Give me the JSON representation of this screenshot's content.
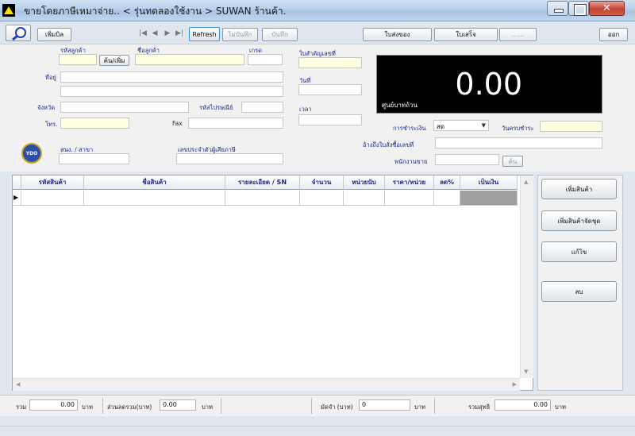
{
  "window": {
    "title": "ขายโดยภาษีเหมาจ่าย.. < รุ่นทดลองใช้งาน > SUWAN ร้านค้า.",
    "minimize_glyph": "—",
    "maximize_glyph": "☐",
    "close_glyph": "✕"
  },
  "toolbar": {
    "new_bill_label": "เพิ่มบิล",
    "nav_first": "|◀",
    "nav_prev": "◀",
    "nav_next": "▶",
    "nav_last": "▶|",
    "refresh_label": "Refresh",
    "cancel_save_label": "ไม่บันทึก",
    "save_label": "บันทึก",
    "delivery_note_label": "ใบส่งของ",
    "receipt_label": "ใบเสร็จ",
    "more_label": "......",
    "exit_label": "ออก"
  },
  "form": {
    "customer_code_label": "รหัสลูกค้า",
    "customer_code_value": "",
    "search_add_label": "ค้น/เพิ่ม",
    "customer_name_label": "ชื่อลูกค้า",
    "customer_name_value": "",
    "grade_label": "เกรด",
    "grade_value": "",
    "address_label": "ที่อยู่",
    "address_line1": "",
    "address_line2": "",
    "province_label": "จังหวัด",
    "province_value": "",
    "postcode_label": "รหัสไปรษณีย์",
    "postcode_value": "",
    "phone_label": "โทร.",
    "phone_value": "",
    "fax_label": "Fax",
    "fax_value": "",
    "branch_label": "สนง. / สาขา",
    "branch_value": "",
    "tax_id_label": "เลขประจำตัวผู้เสียภาษี",
    "tax_id_value": "",
    "receipt_no_label": "ใบสำคัญเลขที่",
    "receipt_no_value": "",
    "date_label": "วันที่",
    "date_value": "",
    "time_label": "เวลา",
    "time_value": "",
    "payment_label": "การชำระเงิน",
    "payment_selected": "สด",
    "due_date_label": "วันครบชำระ",
    "due_date_value": "",
    "ref_purchase_label": "อ้างถึงใบสั่งซื้อเลขที่",
    "ref_purchase_value": "",
    "salesperson_label": "พนักงานขาย",
    "salesperson_value": "",
    "salesperson_search_label": "ค้น",
    "logo_text": "YDO"
  },
  "display": {
    "amount": "0.00",
    "unit_text": "ศูนย์บาทถ้วน"
  },
  "grid": {
    "columns": [
      "รหัสสินค้า",
      "ชื่อสินค้า",
      "รายละเอียด / SN",
      "จำนวน",
      "หน่วยนับ",
      "ราคา/หน่วย",
      "ลด%",
      "เป็นเงิน"
    ],
    "row_marker": "▶"
  },
  "side_buttons": {
    "add_product": "เพิ่มสินค้า",
    "add_product_set": "เพิ่มสินค้าจัดชุด",
    "edit": "แก้ไข",
    "delete": "ลบ"
  },
  "footer": {
    "total_label": "รวม",
    "total_value": "0.00",
    "total_unit": "บาท",
    "discount_label": "ส่วนลดรวม(บาท)",
    "discount_value": "0.00",
    "discount_unit": "บาท",
    "deposit_label": "มัดจำ (บาท)",
    "deposit_value": "0",
    "deposit_unit": "บาท",
    "net_label": "รวมสุทธิ",
    "net_value": "0.00",
    "net_unit": "บาท"
  }
}
